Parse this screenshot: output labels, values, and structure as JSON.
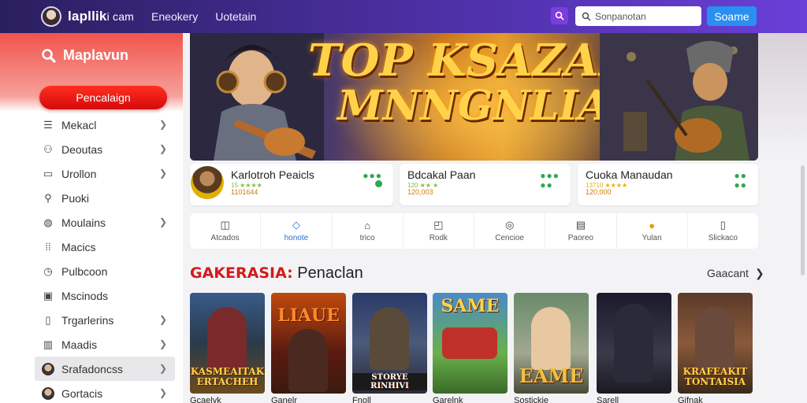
{
  "header": {
    "site_name": "lapllik",
    "site_suffix": "i cam",
    "links": [
      "Eneokery",
      "Uotetain"
    ],
    "search_placeholder": "Sonpanotan",
    "search_button": "Soame"
  },
  "sidebar": {
    "brand": "Maplavun",
    "cta": "Pencalaign",
    "items": [
      {
        "label": "Mekacl",
        "icon": "list-icon",
        "chevron": true
      },
      {
        "label": "Deoutas",
        "icon": "gamepad-icon",
        "chevron": true
      },
      {
        "label": "Urollon",
        "icon": "window-icon",
        "chevron": true
      },
      {
        "label": "Puoki",
        "icon": "user-icon",
        "chevron": false
      },
      {
        "label": "Moulains",
        "icon": "globe-icon",
        "chevron": true
      },
      {
        "label": "Macics",
        "icon": "grid-icon",
        "chevron": false
      },
      {
        "label": "Pulbcoon",
        "icon": "clock-icon",
        "chevron": false
      },
      {
        "label": "Mscinods",
        "icon": "image-icon",
        "chevron": false
      },
      {
        "label": "Trgarlerins",
        "icon": "bookmark-icon",
        "chevron": true
      },
      {
        "label": "Maadis",
        "icon": "chart-icon",
        "chevron": true
      },
      {
        "label": "Srafadoncss",
        "icon": "avatar",
        "chevron": true,
        "active": true
      },
      {
        "label": "Gortacis",
        "icon": "avatar",
        "chevron": true
      }
    ]
  },
  "banner": {
    "line1": "TOP KSAZAN",
    "line2": "MNNGNLIA"
  },
  "featured": [
    {
      "name": "Karlotroh Peaicls",
      "meta": "15 ★★★★",
      "count": "1101644"
    },
    {
      "name": "Bdcakal Paan",
      "meta": "120 ★★ ★",
      "count": "120,003"
    },
    {
      "name": "Cuoka Manaudan",
      "meta": "13710 ★★★★",
      "count": "120,000"
    }
  ],
  "categories": [
    {
      "label": "Atcados",
      "icon": "camera-icon"
    },
    {
      "label": "honote",
      "icon": "tag-icon",
      "active": true
    },
    {
      "label": "trico",
      "icon": "home-icon"
    },
    {
      "label": "Rodk",
      "icon": "photo-icon"
    },
    {
      "label": "Cencioe",
      "icon": "circle-icon"
    },
    {
      "label": "Paoreo",
      "icon": "book-icon"
    },
    {
      "label": "Yulan",
      "icon": "coin-icon"
    },
    {
      "label": "Slickaco",
      "icon": "panel-icon"
    }
  ],
  "section": {
    "title_highlight": "GAKERASIA:",
    "title_rest": " Penaclan",
    "link": "Gaacant"
  },
  "games": [
    {
      "caption": "KASMEAITAK ERTACHEH",
      "label": "Gcaelyk"
    },
    {
      "caption": "LIAUE",
      "label": "Ganelr"
    },
    {
      "caption": "STORYE RINHIVI",
      "label": "Fnoll"
    },
    {
      "caption": "SAME",
      "label": "Garelnk"
    },
    {
      "caption": "EAME",
      "label": "Sostickie"
    },
    {
      "caption": "",
      "label": "Sarell"
    },
    {
      "caption": "KRAFEAKIT TONTAISIA",
      "label": "Gifnak"
    }
  ]
}
